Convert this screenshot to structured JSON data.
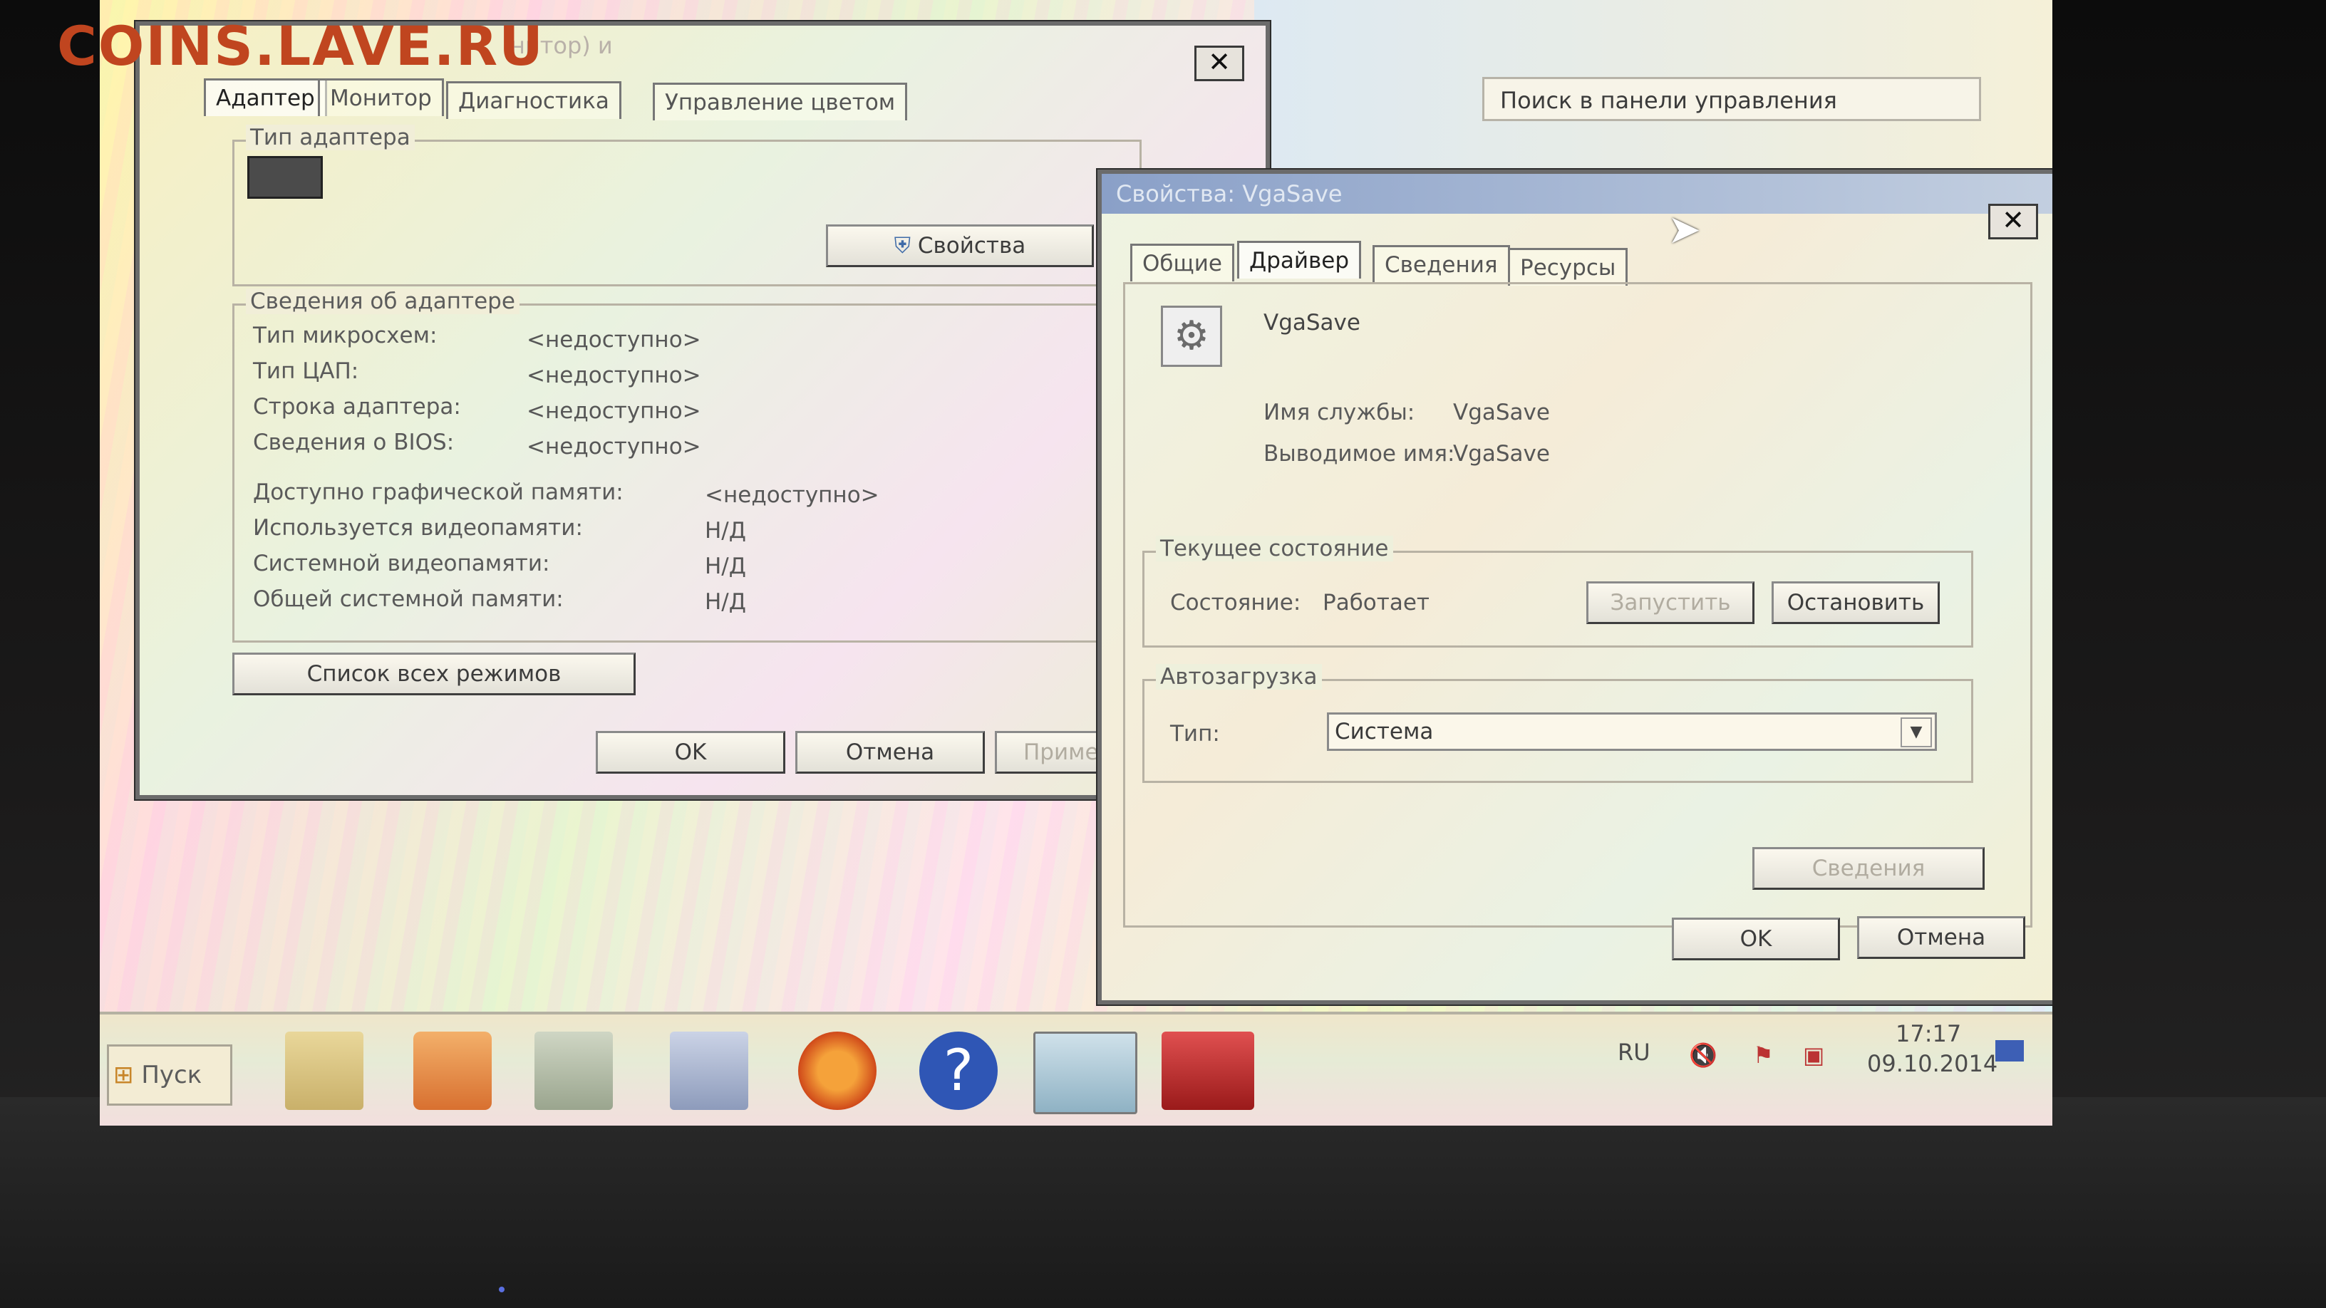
{
  "watermark": "COINS.LAVE.RU",
  "control_panel": {
    "search_placeholder": "Поиск в панели управления"
  },
  "adapter_window": {
    "title": "нитор) и",
    "close": "✕",
    "tabs": [
      "Адаптер",
      "Монитор",
      "Диагностика",
      "Управление цветом"
    ],
    "adapter_type_group": "Тип адаптера",
    "properties_button": "Свойства",
    "info_group": "Сведения об адаптере",
    "rows": [
      {
        "label": "Тип микросхем:",
        "value": "<недоступно>"
      },
      {
        "label": "Тип ЦАП:",
        "value": "<недоступно>"
      },
      {
        "label": "Строка адаптера:",
        "value": "<недоступно>"
      },
      {
        "label": "Сведения о BIOS:",
        "value": "<недоступно>"
      }
    ],
    "memory_rows": [
      {
        "label": "Доступно графической памяти:",
        "value": "<недоступно>"
      },
      {
        "label": "Используется видеопамяти:",
        "value": "Н/Д"
      },
      {
        "label": "Системной видеопамяти:",
        "value": "Н/Д"
      },
      {
        "label": "Общей системной памяти:",
        "value": "Н/Д"
      }
    ],
    "list_modes_button": "Список всех режимов",
    "ok": "OK",
    "cancel": "Отмена",
    "apply": "Примени"
  },
  "service_window": {
    "title": "Свойства: VgaSave",
    "close": "✕",
    "tabs": [
      "Общие",
      "Драйвер",
      "Сведения",
      "Ресурсы"
    ],
    "active_tab": "Драйвер",
    "service_name": "VgaSave",
    "service_name_label": "Имя службы:",
    "service_name_value": "VgaSave",
    "display_name_label": "Выводимое имя:",
    "display_name_value": "VgaSave",
    "current_state_group": "Текущее состояние",
    "state_label": "Состояние:",
    "state_value": "Работает",
    "start_button": "Запустить",
    "stop_button": "Остановить",
    "autostart_group": "Автозагрузка",
    "type_label": "Тип:",
    "type_value": "Система",
    "details_button": "Сведения",
    "ok": "OK",
    "cancel": "Отмена"
  },
  "taskbar": {
    "start": "Пуск",
    "language": "RU",
    "time": "17:17",
    "date": "09.10.2014"
  }
}
